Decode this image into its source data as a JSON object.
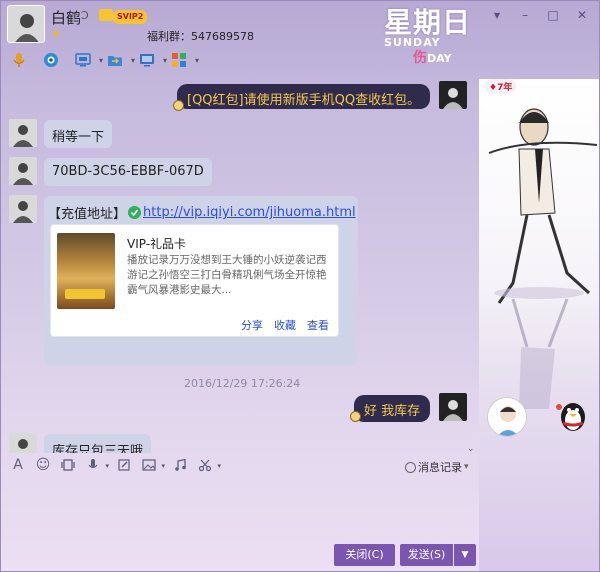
{
  "contact": {
    "name": "白鹤",
    "name_mark": "Ɔ",
    "vip_badge": "SVIP2",
    "star": "★",
    "welfare": "福利群：547689578"
  },
  "weekday": {
    "cn": "星期日",
    "en": "SUNDAY",
    "mood_char": "伤",
    "mood_en": "DAY"
  },
  "window_buttons": {
    "minimize": "▾",
    "restore": "–",
    "maximize": "□",
    "close": "✕"
  },
  "toolbar": [
    {
      "name": "voice-call-icon",
      "color": "#e7a01e"
    },
    {
      "name": "video-call-icon",
      "color": "#2e8bd6"
    },
    {
      "name": "remote-desktop-icon",
      "color": "#2b77c9"
    },
    {
      "name": "send-file-icon",
      "color": "#3d85d6"
    },
    {
      "name": "screen-share-icon",
      "color": "#3a6fbd"
    },
    {
      "name": "apps-icon",
      "color": "#e85b3a"
    }
  ],
  "messages": {
    "out1": "[QQ红包]请使用新版手机QQ查收红包。",
    "in1": "稍等一下",
    "in2": "70BD-3C56-EBBF-067D",
    "card_label": "【充值地址】",
    "card_link": "http://vip.iqiyi.com/jihuoma.html",
    "card_title": "VIP-礼品卡",
    "card_desc": "播放记录万万没想到王大锤的小妖逆袭记西游记之孙悟空三打白骨精巩俐气场全开惊艳霸气风暴港影史最大...",
    "card_share": "分享",
    "card_collect": "收藏",
    "card_view": "查看",
    "timestamp": "2016/12/29 17:26:24",
    "out2": "好 我库存",
    "in3": "库存只包三天哦"
  },
  "input_toolbar": {
    "font": "A",
    "emoji": "☺",
    "history_label": "消息记录",
    "history_dd": "▾"
  },
  "buttons": {
    "close": "关闭(C)",
    "send": "发送(S)",
    "send_dd": "▼"
  },
  "right_panel": {
    "years_badge": "7年"
  }
}
